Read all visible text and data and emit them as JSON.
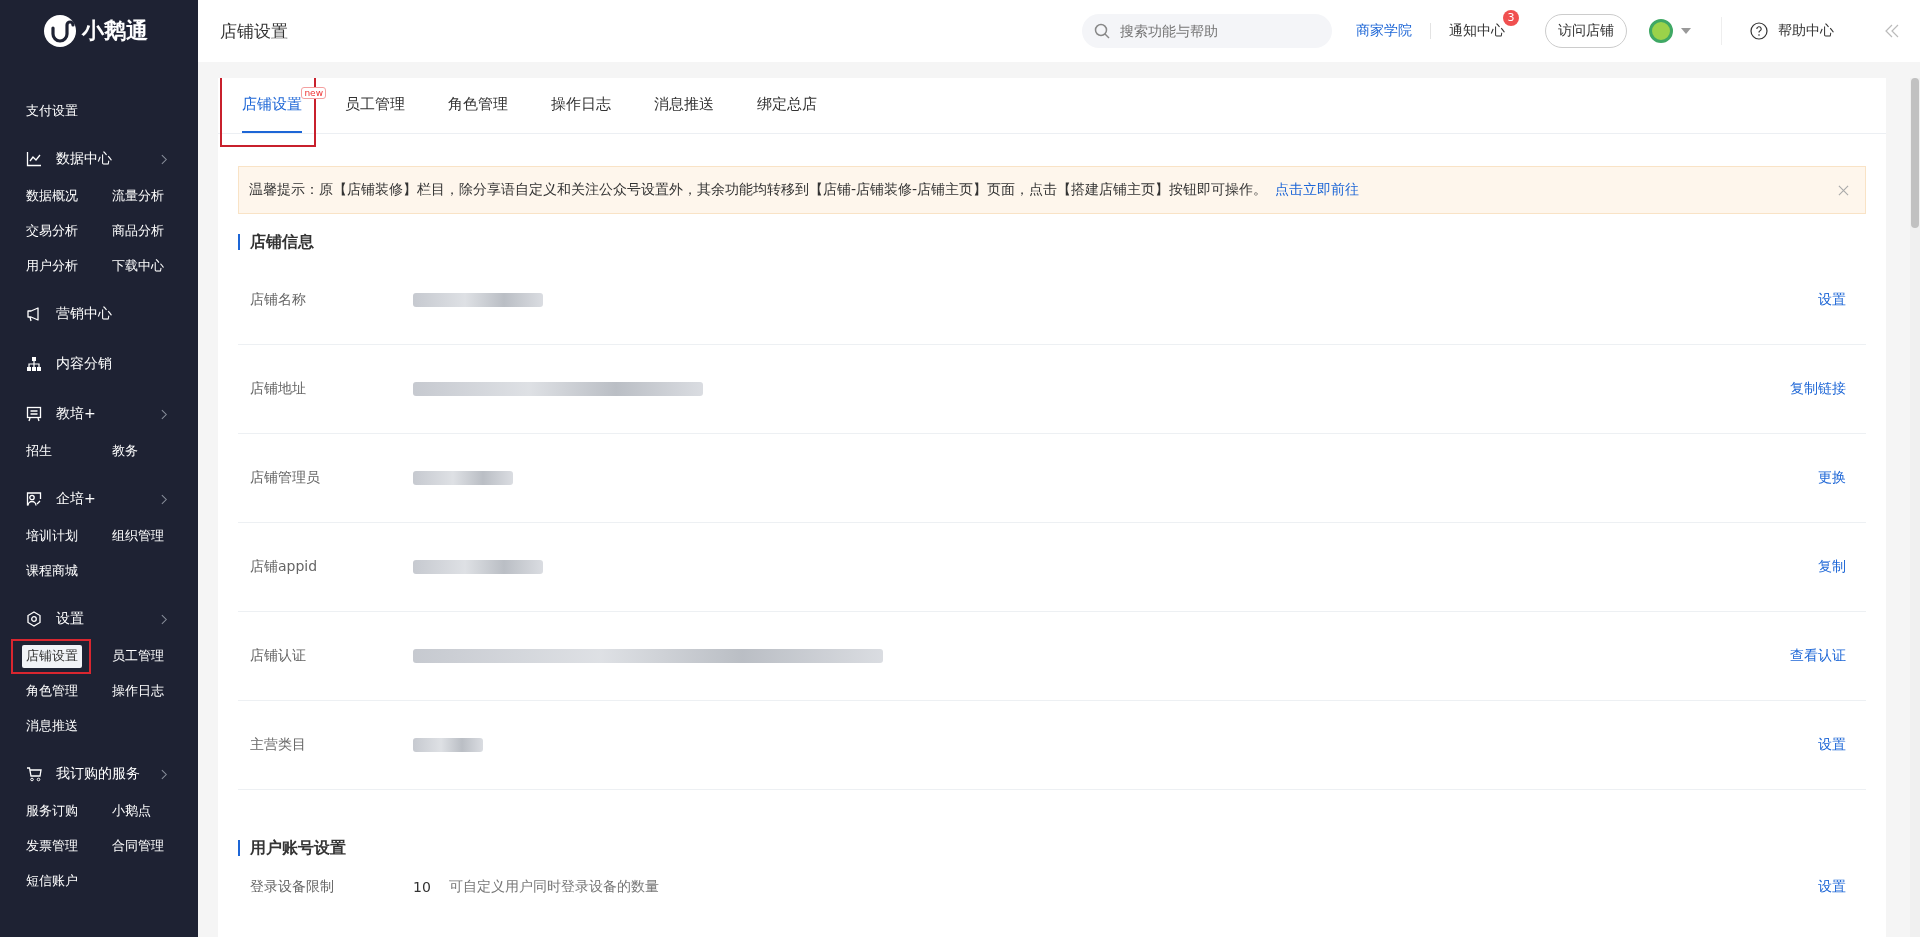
{
  "sidebar": {
    "logo": "小鹅通",
    "groups": [
      {
        "items": [
          {
            "label": "支付设置",
            "selected": false
          }
        ]
      },
      {
        "title": "数据中心",
        "expandable": true,
        "items": [
          {
            "label": "数据概况",
            "selected": false
          },
          {
            "label": "流量分析",
            "selected": false
          },
          {
            "label": "交易分析",
            "selected": false
          },
          {
            "label": "商品分析",
            "selected": false
          },
          {
            "label": "用户分析",
            "selected": false
          },
          {
            "label": "下载中心",
            "selected": false
          }
        ]
      },
      {
        "title": "营销中心",
        "expandable": false
      },
      {
        "title": "内容分销",
        "expandable": false
      },
      {
        "title": "教培+",
        "expandable": true,
        "items": [
          {
            "label": "招生",
            "selected": false
          },
          {
            "label": "教务",
            "selected": false
          }
        ]
      },
      {
        "title": "企培+",
        "expandable": true,
        "items": [
          {
            "label": "培训计划",
            "selected": false
          },
          {
            "label": "组织管理",
            "selected": false
          },
          {
            "label": "课程商城",
            "selected": false
          }
        ]
      },
      {
        "title": "设置",
        "expandable": true,
        "items": [
          {
            "label": "店铺设置",
            "selected": true,
            "highlighted": true
          },
          {
            "label": "员工管理",
            "selected": false
          },
          {
            "label": "角色管理",
            "selected": false
          },
          {
            "label": "操作日志",
            "selected": false
          },
          {
            "label": "消息推送",
            "selected": false
          }
        ]
      },
      {
        "title": "我订购的服务",
        "expandable": true,
        "items": [
          {
            "label": "服务订购",
            "selected": false
          },
          {
            "label": "小鹅点",
            "selected": false
          },
          {
            "label": "发票管理",
            "selected": false
          },
          {
            "label": "合同管理",
            "selected": false
          },
          {
            "label": "短信账户",
            "selected": false
          }
        ]
      }
    ]
  },
  "header": {
    "title": "店铺设置",
    "search": {
      "placeholder": "搜索功能与帮助"
    },
    "academy_link": "商家学院",
    "notifications": {
      "label": "通知中心",
      "badge": "3"
    },
    "visit_button": "访问店铺",
    "help": "帮助中心"
  },
  "tabs": [
    {
      "label": "店铺设置",
      "selected": true,
      "badge": "new",
      "highlighted": true
    },
    {
      "label": "员工管理",
      "selected": false
    },
    {
      "label": "角色管理",
      "selected": false
    },
    {
      "label": "操作日志",
      "selected": false
    },
    {
      "label": "消息推送",
      "selected": false
    },
    {
      "label": "绑定总店",
      "selected": false
    }
  ],
  "notice": {
    "text": "温馨提示：原【店铺装修】栏目，除分享语自定义和关注公众号设置外，其余功能均转移到【店铺-店铺装修-店铺主页】页面，点击【搭建店铺主页】按钮即可操作。",
    "link": "点击立即前往"
  },
  "store_info": {
    "title": "店铺信息",
    "rows": [
      {
        "label": "店铺名称",
        "action": "设置"
      },
      {
        "label": "店铺地址",
        "action": "复制链接"
      },
      {
        "label": "店铺管理员",
        "action": "更换"
      },
      {
        "label": "店铺appid",
        "action": "复制"
      },
      {
        "label": "店铺认证",
        "action": "查看认证"
      },
      {
        "label": "主营类目",
        "action": "设置"
      }
    ]
  },
  "account_settings": {
    "title": "用户账号设置",
    "rows": [
      {
        "label": "登录设备限制",
        "value": "10",
        "hint": "可自定义用户同时登录设备的数量",
        "action": "设置"
      }
    ]
  }
}
